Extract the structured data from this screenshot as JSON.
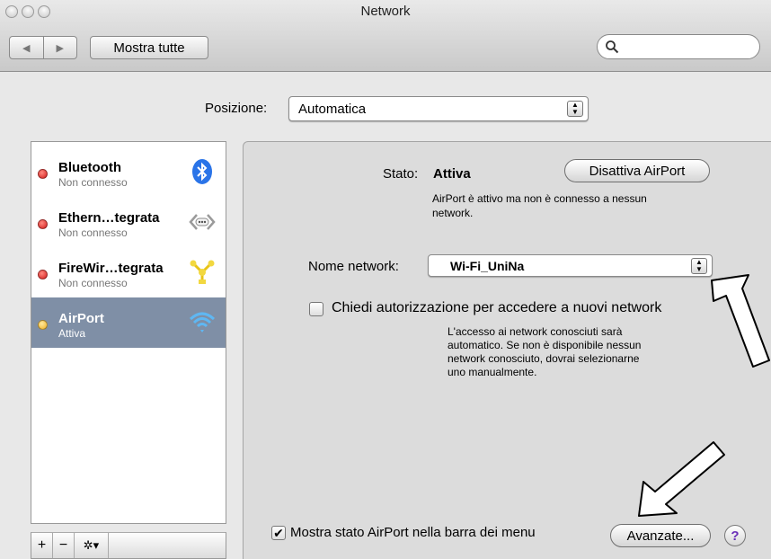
{
  "window": {
    "title": "Network"
  },
  "toolbar": {
    "back_glyph": "◀",
    "forward_glyph": "▶",
    "show_all_label": "Mostra tutte",
    "search_placeholder": ""
  },
  "location": {
    "label": "Posizione:",
    "value": "Automatica"
  },
  "services": [
    {
      "name": "Bluetooth",
      "status": "Non connesso",
      "status_color": "#d41a1a",
      "icon": "bluetooth-icon",
      "selected": false
    },
    {
      "name": "Ethern…tegrata",
      "status": "Non connesso",
      "status_color": "#d41a1a",
      "icon": "ethernet-icon",
      "selected": false
    },
    {
      "name": "FireWir…tegrata",
      "status": "Non connesso",
      "status_color": "#d41a1a",
      "icon": "firewire-icon",
      "selected": false
    },
    {
      "name": "AirPort",
      "status": "Attiva",
      "status_color": "#f0b020",
      "icon": "wifi-icon",
      "selected": true
    }
  ],
  "sidebar_controls": {
    "add": "+",
    "remove": "−",
    "action": "✲▾"
  },
  "detail": {
    "status_label": "Stato:",
    "status_value": "Attiva",
    "toggle_button": "Disattiva AirPort",
    "status_description_line1": "AirPort è attivo ma non è connesso a nessun",
    "status_description_line2": "network.",
    "network_name_label": "Nome network:",
    "network_name_value": "Wi-Fi_UniNa",
    "ask_join_label": "Chiedi autorizzazione per accedere a nuovi network",
    "ask_join_checked": false,
    "ask_join_desc_line1": "L'accesso ai network conosciuti sarà",
    "ask_join_desc_line2": "automatico. Se non è disponibile nessun",
    "ask_join_desc_line3": "network conosciuto, dovrai selezionarne",
    "ask_join_desc_line4": "uno manualmente.",
    "show_status_label": "Mostra stato AirPort nella barra dei menu",
    "show_status_checked": true,
    "advanced_button": "Avanzate...",
    "help_glyph": "?"
  },
  "colors": {
    "selection": "#7f8fa6",
    "bluetooth": "#2a74e8",
    "wifi": "#48a6ec",
    "firewire": "#e8c418"
  }
}
